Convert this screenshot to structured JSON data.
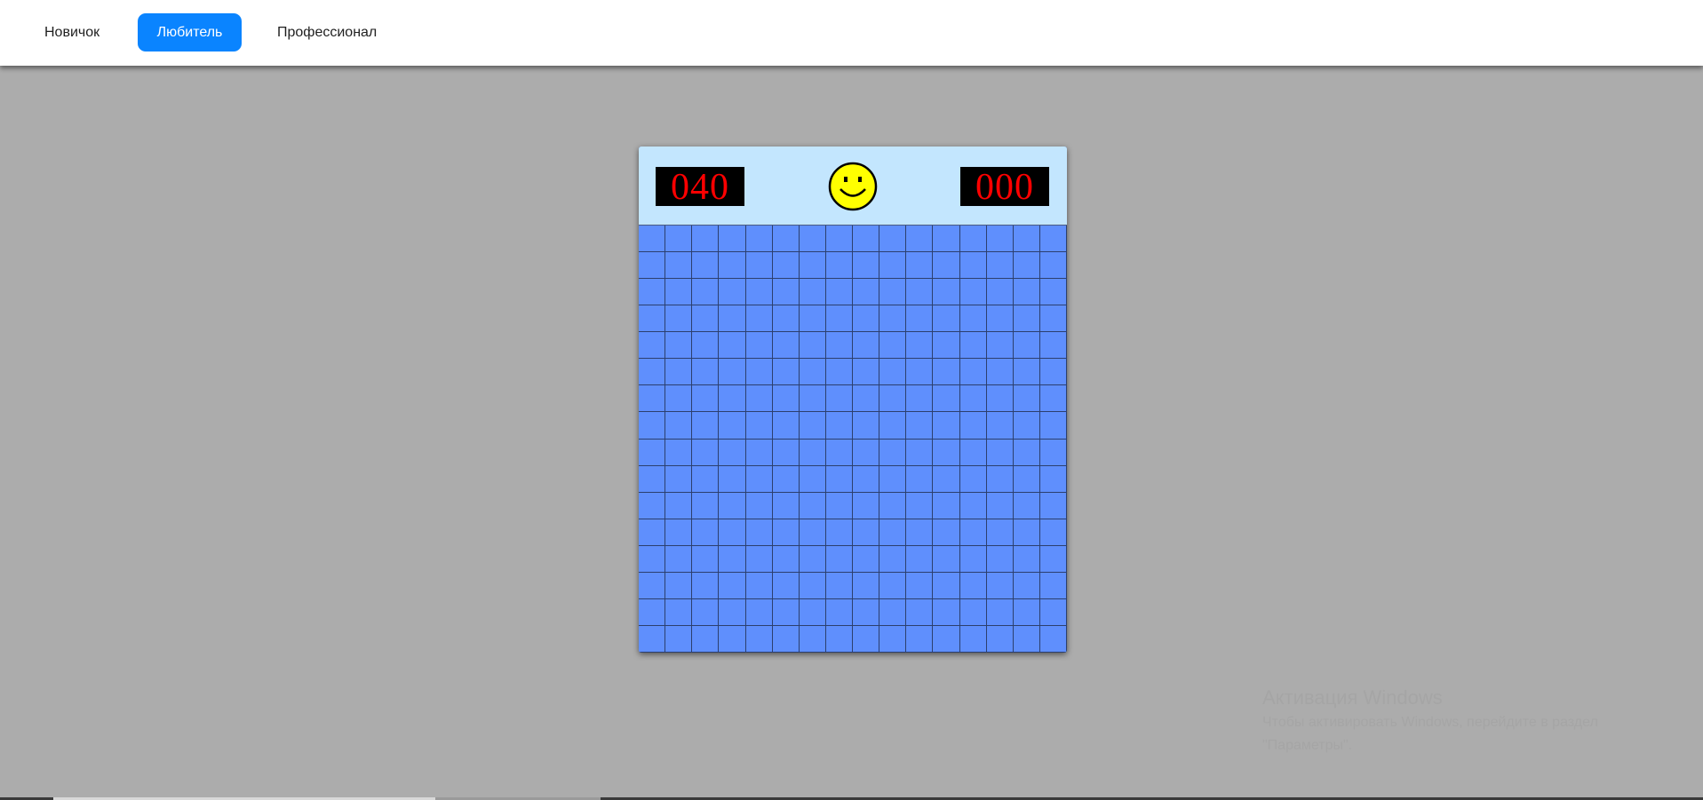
{
  "nav": {
    "modes": [
      {
        "label": "Новичок",
        "active": false
      },
      {
        "label": "Любитель",
        "active": true
      },
      {
        "label": "Профессионал",
        "active": false
      }
    ],
    "active_color": "#0a84ff"
  },
  "game": {
    "mines_left": "040",
    "timer": "000",
    "face": "smiley-face",
    "rows": 16,
    "cols": 16,
    "cell_color": "#5f8ffd",
    "panel_color": "#c3e6fe",
    "counter_color": "#ff0000"
  },
  "watermark": {
    "title": "Активация Windows",
    "line1": "Чтобы активировать Windows, перейдите в раздел",
    "line2": "\"Параметры\"."
  }
}
